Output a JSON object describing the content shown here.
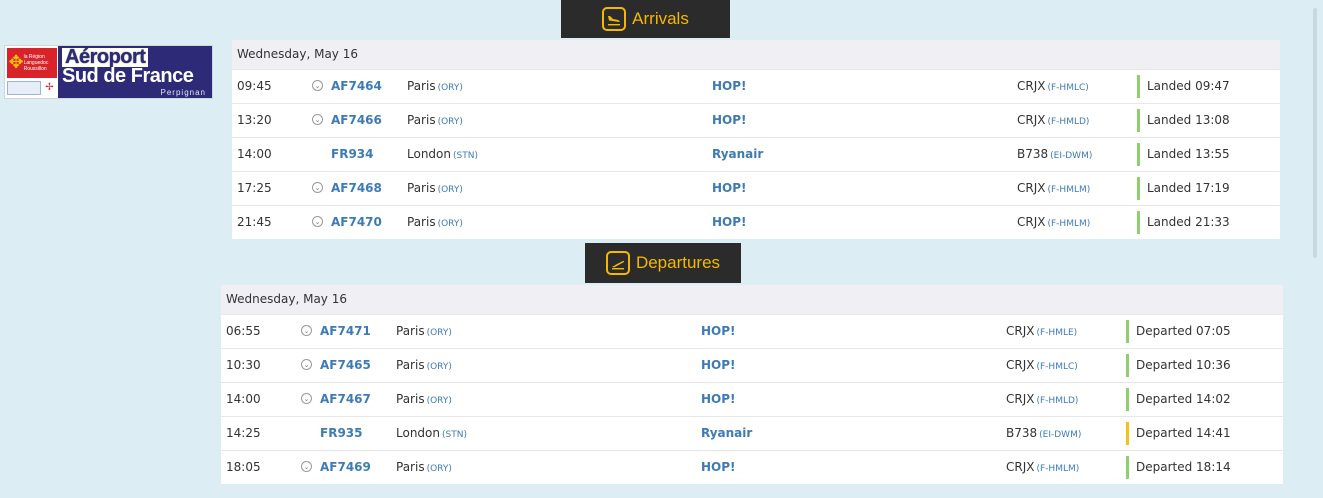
{
  "logo": {
    "line1": "Aéroport",
    "line2": "Sud de France",
    "line3": "Perpignan",
    "region_text": "la Région Languedoc Roussillon"
  },
  "arrivals": {
    "title": "Arrivals",
    "date": "Wednesday, May 16",
    "flights": [
      {
        "time": "09:45",
        "code": "AF7464",
        "has_chev": true,
        "city": "Paris",
        "iata": "(ORY)",
        "airline": "HOP!",
        "aircraft": "CRJX",
        "reg": "(F-HMLC)",
        "status": "Landed 09:47",
        "status_color": "#8ed06f"
      },
      {
        "time": "13:20",
        "code": "AF7466",
        "has_chev": true,
        "city": "Paris",
        "iata": "(ORY)",
        "airline": "HOP!",
        "aircraft": "CRJX",
        "reg": "(F-HMLD)",
        "status": "Landed 13:08",
        "status_color": "#8ed06f"
      },
      {
        "time": "14:00",
        "code": "FR934",
        "has_chev": false,
        "city": "London",
        "iata": "(STN)",
        "airline": "Ryanair",
        "aircraft": "B738",
        "reg": "(EI-DWM)",
        "status": "Landed 13:55",
        "status_color": "#8ed06f"
      },
      {
        "time": "17:25",
        "code": "AF7468",
        "has_chev": true,
        "city": "Paris",
        "iata": "(ORY)",
        "airline": "HOP!",
        "aircraft": "CRJX",
        "reg": "(F-HMLM)",
        "status": "Landed 17:19",
        "status_color": "#8ed06f"
      },
      {
        "time": "21:45",
        "code": "AF7470",
        "has_chev": true,
        "city": "Paris",
        "iata": "(ORY)",
        "airline": "HOP!",
        "aircraft": "CRJX",
        "reg": "(F-HMLM)",
        "status": "Landed 21:33",
        "status_color": "#8ed06f"
      }
    ]
  },
  "departures": {
    "title": "Departures",
    "date": "Wednesday, May 16",
    "flights": [
      {
        "time": "06:55",
        "code": "AF7471",
        "has_chev": true,
        "city": "Paris",
        "iata": "(ORY)",
        "airline": "HOP!",
        "aircraft": "CRJX",
        "reg": "(F-HMLE)",
        "status": "Departed 07:05",
        "status_color": "#8ed06f"
      },
      {
        "time": "10:30",
        "code": "AF7465",
        "has_chev": true,
        "city": "Paris",
        "iata": "(ORY)",
        "airline": "HOP!",
        "aircraft": "CRJX",
        "reg": "(F-HMLC)",
        "status": "Departed 10:36",
        "status_color": "#8ed06f"
      },
      {
        "time": "14:00",
        "code": "AF7467",
        "has_chev": true,
        "city": "Paris",
        "iata": "(ORY)",
        "airline": "HOP!",
        "aircraft": "CRJX",
        "reg": "(F-HMLD)",
        "status": "Departed 14:02",
        "status_color": "#8ed06f"
      },
      {
        "time": "14:25",
        "code": "FR935",
        "has_chev": false,
        "city": "London",
        "iata": "(STN)",
        "airline": "Ryanair",
        "aircraft": "B738",
        "reg": "(EI-DWM)",
        "status": "Departed 14:41",
        "status_color": "#f0c419"
      },
      {
        "time": "18:05",
        "code": "AF7469",
        "has_chev": true,
        "city": "Paris",
        "iata": "(ORY)",
        "airline": "HOP!",
        "aircraft": "CRJX",
        "reg": "(F-HMLM)",
        "status": "Departed 18:14",
        "status_color": "#8ed06f"
      }
    ]
  },
  "icons": {
    "arrivals": "plane-landing-icon",
    "departures": "plane-takeoff-icon",
    "expand": "chevron-down-icon"
  }
}
